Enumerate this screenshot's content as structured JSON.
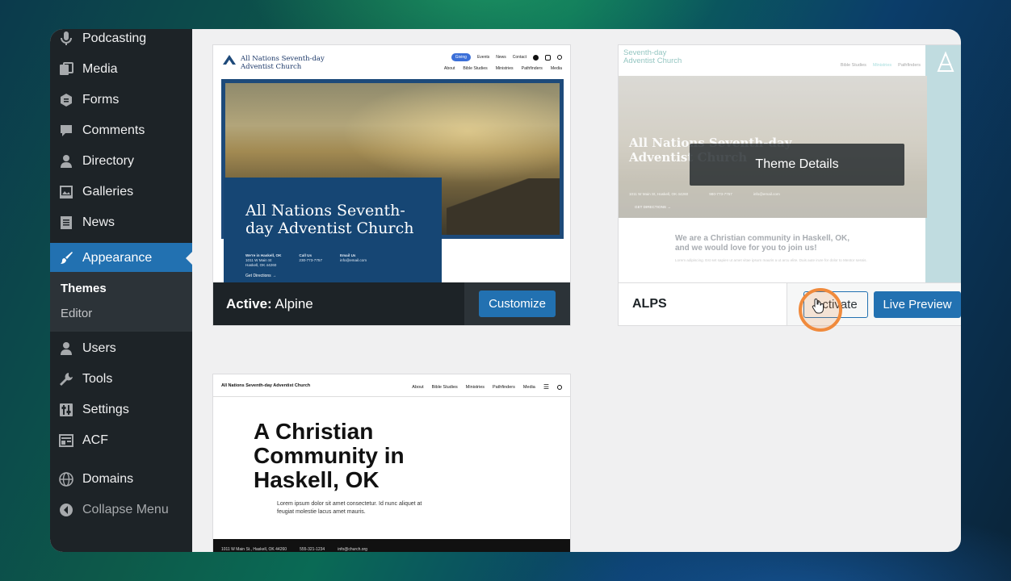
{
  "sidebar": {
    "items_top": [
      {
        "label": "Podcasting",
        "icon": "microphone-icon"
      },
      {
        "label": "Media",
        "icon": "media-icon"
      },
      {
        "label": "Forms",
        "icon": "forms-icon"
      },
      {
        "label": "Comments",
        "icon": "comment-icon"
      },
      {
        "label": "Directory",
        "icon": "user-icon"
      },
      {
        "label": "Galleries",
        "icon": "gallery-icon"
      },
      {
        "label": "News",
        "icon": "document-icon"
      }
    ],
    "active": {
      "label": "Appearance",
      "icon": "paintbrush-icon"
    },
    "submenu": [
      "Themes",
      "Editor"
    ],
    "items_bottom": [
      {
        "label": "Users",
        "icon": "user-icon"
      },
      {
        "label": "Tools",
        "icon": "wrench-icon"
      },
      {
        "label": "Settings",
        "icon": "settings-icon"
      },
      {
        "label": "ACF",
        "icon": "acf-icon"
      }
    ],
    "domains": "Domains",
    "collapse": "Collapse Menu"
  },
  "themes": {
    "alpine": {
      "active_prefix": "Active:",
      "name": "Alpine",
      "customize": "Customize",
      "site_name_1": "All Nations Seventh-day",
      "site_name_2": "Adventist Church",
      "nav_top": [
        "Giving",
        "Events",
        "News",
        "Contact"
      ],
      "nav_main": [
        "About",
        "Bible Studies",
        "Ministries",
        "Pathfinders",
        "Media"
      ],
      "hero_title_1": "All Nations Seventh-",
      "hero_title_2": "day Adventist Church",
      "info": [
        {
          "head": "We're in Haskell, OK",
          "lines": [
            "1011 W Main St",
            "Haskell, OK 44260"
          ]
        },
        {
          "head": "Call Us",
          "lines": [
            "230-773-7757"
          ]
        },
        {
          "head": "Email Us",
          "lines": [
            "info@email.com"
          ]
        }
      ],
      "directions": "Get Directions →"
    },
    "alps": {
      "name": "ALPS",
      "activate": "Activate",
      "live_preview": "Live Preview",
      "overlay": "Theme Details",
      "site_name_1": "Seventh-day",
      "site_name_2": "Adventist Church",
      "nav": [
        "Bible Studies",
        "Ministries",
        "Pathfinders"
      ],
      "hero_title_1": "All Nations Seventh-day",
      "hero_title_2": "Adventist Church",
      "info": [
        "1011 W Main St, Haskell, OK 44260",
        "980-773-7757",
        "info@email.com"
      ],
      "directions": "GET DIRECTIONS →",
      "tagline_1": "We are a Christian community in Haskell, OK,",
      "tagline_2": "and we would love for you to join us!",
      "body_text": "Lorem adipiscing. Est set sapien ut amet vitae ipsum mauris a ut arcu elite. Duis aute irure for dolor to Mentor sessis."
    },
    "third": {
      "site_name": "All Nations Seventh-day Adventist Church",
      "nav": [
        "About",
        "Bible Studies",
        "Ministries",
        "Pathfinders",
        "Media"
      ],
      "hero_1": "A Christian",
      "hero_2": "Community in",
      "hero_3": "Haskell, OK",
      "lorem_1": "Lorem ipsum dolor sit amet consectetur. Id nunc aliquet at",
      "lorem_2": "feugiat molestie lacus amet mauris.",
      "footer": [
        "1011 W Main St., Haskell, OK 44260",
        "555-321-1234",
        "info@church.org"
      ]
    }
  },
  "colors": {
    "wp_blue": "#2271b1",
    "sidebar_bg": "#1d2327",
    "cursor_ring": "#f08a3c"
  }
}
